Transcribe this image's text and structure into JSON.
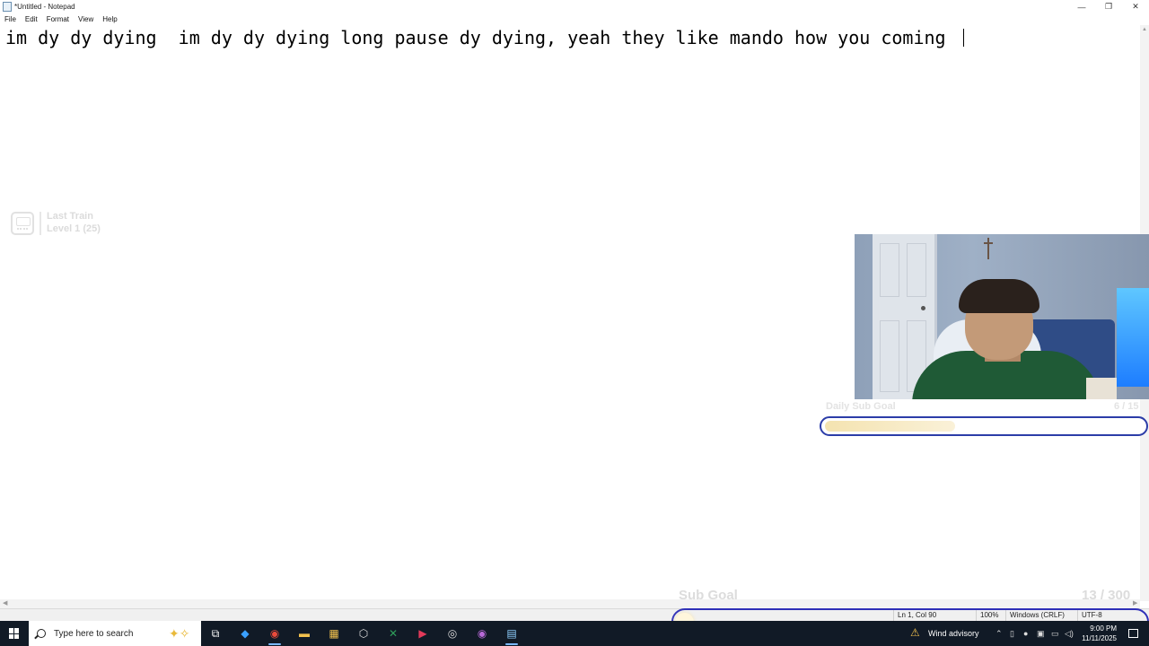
{
  "window": {
    "title": "*Untitled - Notepad",
    "minimize_glyph": "—",
    "maximize_glyph": "❐",
    "close_glyph": "✕"
  },
  "menu": [
    "File",
    "Edit",
    "Format",
    "View",
    "Help"
  ],
  "editor": {
    "text": "im dy dy dying  im dy dy dying long pause dy dying, yeah they like mando how you coming "
  },
  "overlay": {
    "train": {
      "title": "Last Train",
      "level": "Level 1 (25)",
      "icon": "train-icon"
    },
    "daily_goal": {
      "label": "Daily Sub Goal",
      "count": "6 / 15",
      "progress": 0.4
    },
    "sub_goal": {
      "label": "Sub Goal",
      "count": "13 / 300",
      "progress": 0.043
    }
  },
  "statusbar": {
    "position": "Ln 1, Col 90",
    "zoom": "100%",
    "line_ending": "Windows (CRLF)",
    "encoding": "UTF-8"
  },
  "taskbar": {
    "search_placeholder": "Type here to search",
    "weather": "Wind advisory",
    "time": "9:00 PM",
    "date": "11/11/2025",
    "pinned": [
      {
        "name": "task-view-icon",
        "glyph": "⧉",
        "color": "#ffffff"
      },
      {
        "name": "copilot-icon",
        "glyph": "◆",
        "color": "#3aa0ff"
      },
      {
        "name": "chrome-icon",
        "glyph": "◉",
        "color": "#e94a3b"
      },
      {
        "name": "file-explorer-icon",
        "glyph": "▬",
        "color": "#f2c14e"
      },
      {
        "name": "store-icon",
        "glyph": "▦",
        "color": "#f2c14e"
      },
      {
        "name": "app-icon",
        "glyph": "⬡",
        "color": "#dddddd"
      },
      {
        "name": "excel-icon",
        "glyph": "✕",
        "color": "#2f9e5b"
      },
      {
        "name": "media-player-icon",
        "glyph": "▶",
        "color": "#e23a5a"
      },
      {
        "name": "obs-icon",
        "glyph": "◎",
        "color": "#dddddd"
      },
      {
        "name": "chrome-profile-icon",
        "glyph": "◉",
        "color": "#b86ad8"
      },
      {
        "name": "notepad-icon",
        "glyph": "▤",
        "color": "#8fd0ff"
      }
    ]
  }
}
